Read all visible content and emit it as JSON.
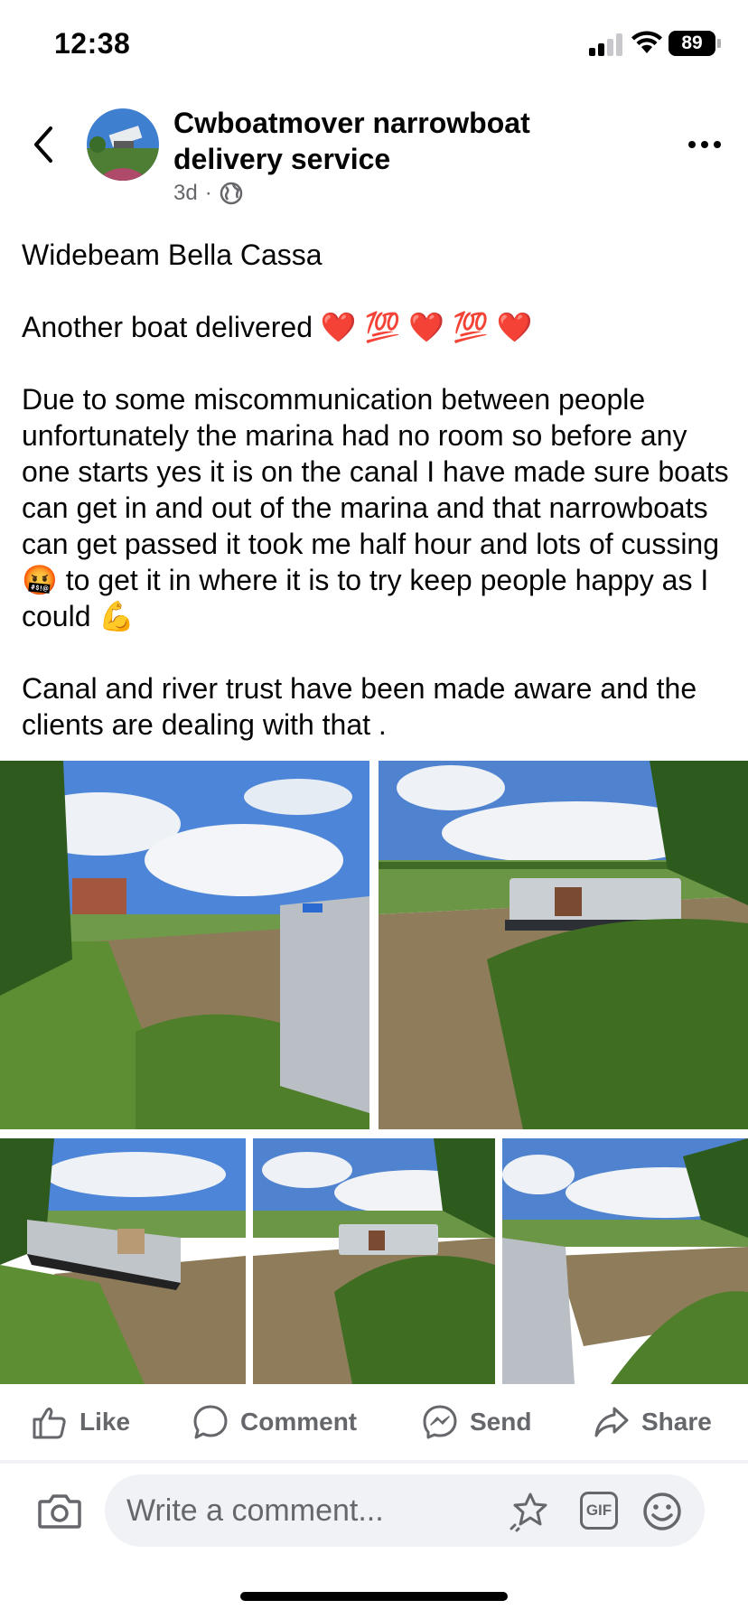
{
  "status_bar": {
    "time": "12:38",
    "battery": "89"
  },
  "header": {
    "page_name": "Cwboatmover narrowboat delivery service",
    "post_age": "3d",
    "separator": "·",
    "audience_icon": "globe-icon"
  },
  "post": {
    "paragraphs": [
      "Widebeam Bella Cassa",
      "Another boat delivered ❤️ 💯 ❤️ 💯 ❤️",
      "Due to some miscommunication between people unfortunately the marina had no room so before any one starts yes it is on the canal I have made sure boats can get in and out of the marina and that narrowboats can get passed it took me half hour and lots of cussing 🤬 to get it in where it is to try keep people happy as I could 💪",
      "Canal and river trust have been made aware and the clients are dealing with that ."
    ]
  },
  "actions": {
    "like": "Like",
    "comment": "Comment",
    "send": "Send",
    "share": "Share"
  },
  "comment_bar": {
    "placeholder": "Write a comment...",
    "gif_label": "GIF"
  },
  "colors": {
    "text": "#050505",
    "secondary": "#65676b",
    "input_bg": "#f0f2f5",
    "sky": "#4f86d6",
    "grass": "#5f8f3a",
    "water": "#8a7a5c"
  }
}
